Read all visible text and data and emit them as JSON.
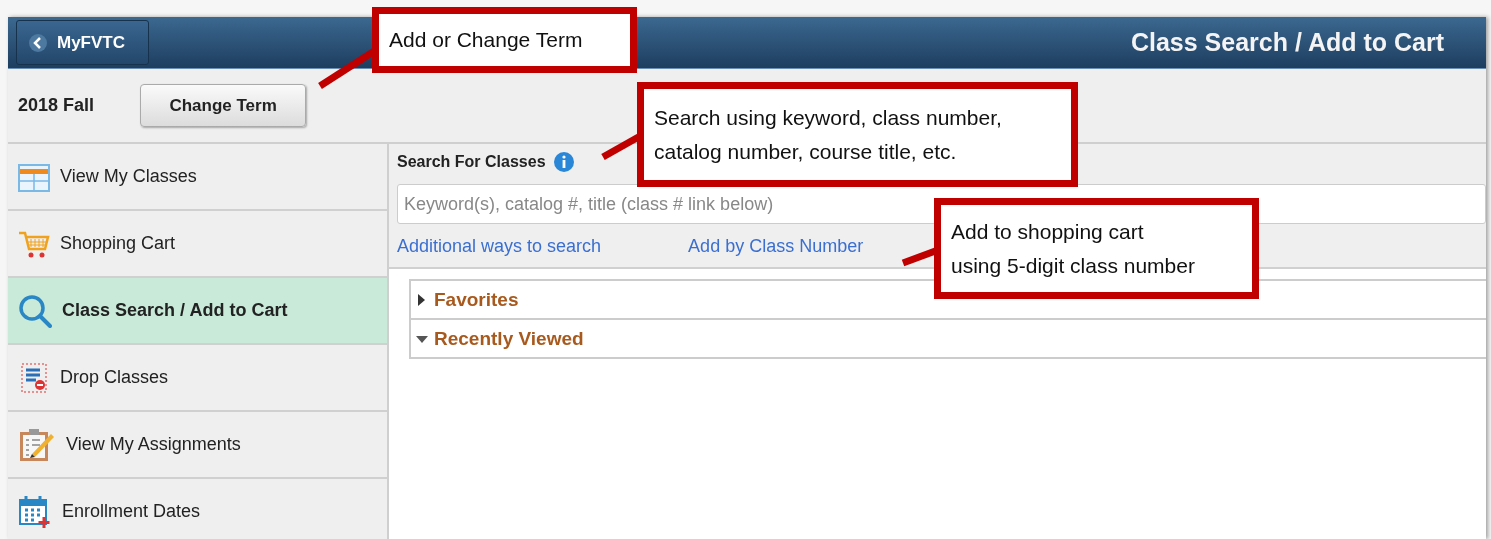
{
  "header": {
    "back_button": "MyFVTC",
    "title": "Class Search / Add to Cart"
  },
  "term": {
    "label": "2018 Fall",
    "button": "Change Term"
  },
  "sidebar": {
    "items": [
      {
        "label": "View My Classes",
        "kind": "calendar",
        "selected": false
      },
      {
        "label": "Shopping Cart",
        "kind": "cart",
        "selected": false
      },
      {
        "label": "Class Search / Add to Cart",
        "kind": "search",
        "selected": true
      },
      {
        "label": "Drop Classes",
        "kind": "drop",
        "selected": false
      },
      {
        "label": "View My Assignments",
        "kind": "assignment",
        "selected": false
      },
      {
        "label": "Enrollment Dates",
        "kind": "dates",
        "selected": false
      }
    ]
  },
  "search": {
    "title": "Search For Classes",
    "placeholder": "Keyword(s), catalog #, title (class # link below)",
    "links": [
      "Additional ways to search",
      "Add by Class Number"
    ]
  },
  "sections": [
    {
      "label": "Favorites",
      "expanded": false
    },
    {
      "label": "Recently Viewed",
      "expanded": true
    }
  ],
  "callouts": [
    {
      "lines": [
        "Add or Change Term"
      ]
    },
    {
      "lines": [
        "Search using keyword, class number,",
        "catalog number, course title, etc."
      ]
    },
    {
      "lines": [
        "Add to shopping cart",
        "using 5-digit class number"
      ]
    }
  ]
}
